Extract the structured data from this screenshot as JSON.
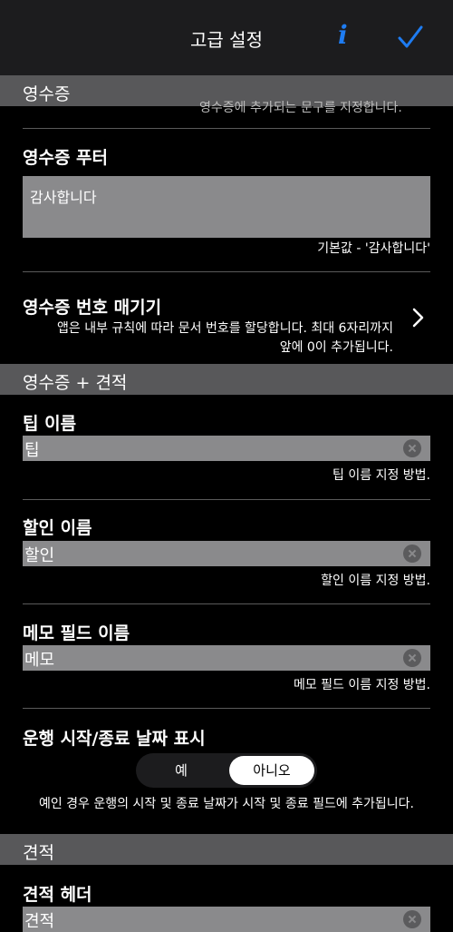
{
  "nav": {
    "title": "고급 설정",
    "info_glyph": "i",
    "info_icon": "info-icon",
    "done_icon": "checkmark-icon",
    "accent": "#1e7cf2"
  },
  "sections": {
    "receipt": "영수증",
    "receipt_quote": "영수증 + 견적",
    "quote": "견적"
  },
  "cut_off_text": "영수증에 추가되는 문구를 지정합니다.",
  "receipt_footer": {
    "label": "영수증 푸터",
    "value": "감사합니다",
    "hint": "기본값 - '감사합니다'"
  },
  "receipt_numbering": {
    "label": "영수증 번호 매기기",
    "desc_line1": "앱은 내부 규칙에 따라 문서 번호를 할당합니다. 최대 6자리까지",
    "desc_line2": "앞에 0이 추가됩니다."
  },
  "tip_name": {
    "label": "팁 이름",
    "value": "팁",
    "hint": "팁 이름 지정 방법."
  },
  "discount_name": {
    "label": "할인 이름",
    "value": "할인",
    "hint": "할인 이름 지정 방법."
  },
  "memo_name": {
    "label": "메모 필드 이름",
    "value": "메모",
    "hint": "메모 필드 이름 지정 방법."
  },
  "trip_dates": {
    "label": "운행 시작/종료 날짜 표시",
    "yes": "예",
    "no": "아니오",
    "selected": "아니오",
    "note": "예인 경우 운행의 시작 및 종료 날짜가 시작 및 종료 필드에 추가됩니다."
  },
  "quote_header": {
    "label": "견적 헤더",
    "value": "견적"
  }
}
